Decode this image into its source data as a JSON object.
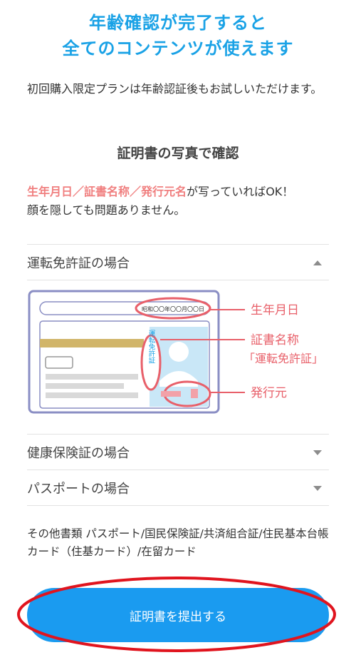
{
  "headline": {
    "line1": "年齢確認が完了すると",
    "line2": "全てのコンテンツが使えます"
  },
  "intro_text": "初回購入限定プランは年齢認証後もお試しいただけます。",
  "section_title": "証明書の写真で確認",
  "note": {
    "highlight": "生年月日／証書名称／発行元名",
    "rest_line1": "が写っていればOK！",
    "line2": "顔を隠しても問題ありません。"
  },
  "accordion": [
    {
      "label": "運転免許証の場合",
      "expanded": true
    },
    {
      "label": "健康保険証の場合",
      "expanded": false
    },
    {
      "label": "パスポートの場合",
      "expanded": false
    }
  ],
  "card_figure": {
    "date_text": "昭和〇〇年〇〇月〇〇日",
    "name_text": "運転免許証",
    "labels": {
      "birth": "生年月日",
      "cert_name": "証書名称",
      "cert_name_sub": "「運転免許証」",
      "issuer": "発行元"
    }
  },
  "other_docs": "その他書類 パスポート/国民保険証/共済組合証/住民基本台帳カード（住基カード）/在留カード",
  "submit_button": {
    "label": "証明書を提出する"
  },
  "colors": {
    "accent_blue": "#1aa2e6",
    "button_blue": "#1a9bf0",
    "highlight_pink": "#f07f7f",
    "annotation_red": "#e8606a",
    "ring_red": "#e0141e"
  }
}
